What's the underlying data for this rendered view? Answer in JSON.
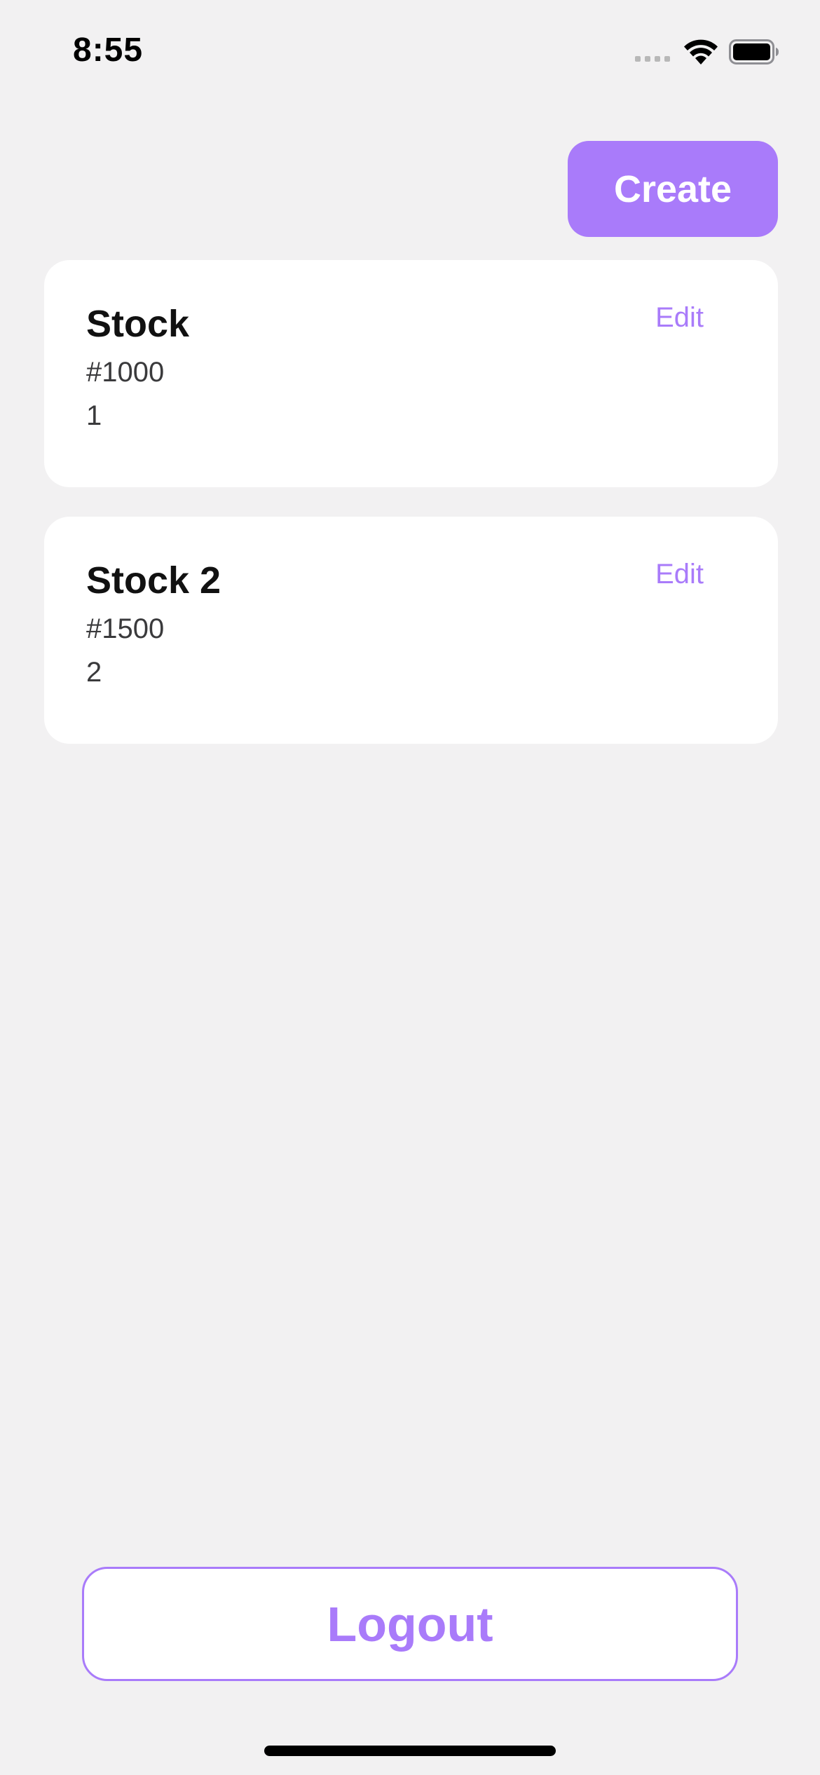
{
  "status_bar": {
    "time": "8:55"
  },
  "header": {
    "create_label": "Create"
  },
  "items": [
    {
      "title": "Stock",
      "code": "#1000",
      "quantity": "1",
      "edit_label": "Edit"
    },
    {
      "title": "Stock 2",
      "code": "#1500",
      "quantity": "2",
      "edit_label": "Edit"
    }
  ],
  "footer": {
    "logout_label": "Logout"
  },
  "colors": {
    "accent": "#a97bfa",
    "background": "#f2f1f2",
    "card": "#ffffff",
    "title_text": "#111111",
    "secondary_text": "#3a3a3c"
  }
}
